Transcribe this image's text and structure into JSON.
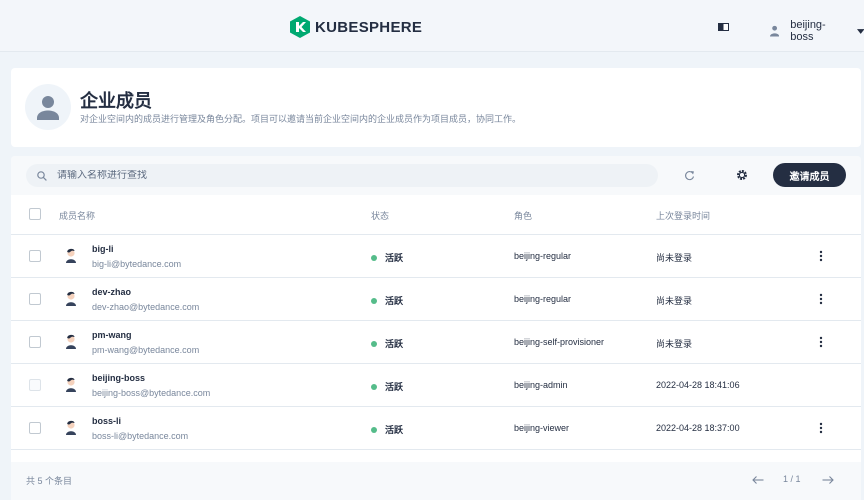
{
  "header": {
    "logo_text": "KUBESPHERE",
    "user_name": "beijing-boss"
  },
  "banner": {
    "title": "企业成员",
    "description": "对企业空间内的成员进行管理及角色分配。项目可以邀请当前企业空间内的企业成员作为项目成员，协同工作。"
  },
  "toolbar": {
    "search_placeholder": "请输入名称进行查找",
    "invite_label": "邀请成员"
  },
  "table": {
    "columns": {
      "name": "成员名称",
      "status": "状态",
      "role": "角色",
      "last_login": "上次登录时间"
    },
    "rows": [
      {
        "name": "big-li",
        "email": "big-li@bytedance.com",
        "status": "活跃",
        "role": "beijing-regular",
        "last_login": "尚未登录"
      },
      {
        "name": "dev-zhao",
        "email": "dev-zhao@bytedance.com",
        "status": "活跃",
        "role": "beijing-regular",
        "last_login": "尚未登录"
      },
      {
        "name": "pm-wang",
        "email": "pm-wang@bytedance.com",
        "status": "活跃",
        "role": "beijing-self-provisioner",
        "last_login": "尚未登录"
      },
      {
        "name": "beijing-boss",
        "email": "beijing-boss@bytedance.com",
        "status": "活跃",
        "role": "beijing-admin",
        "last_login": "2022-04-28 18:41:06"
      },
      {
        "name": "boss-li",
        "email": "boss-li@bytedance.com",
        "status": "活跃",
        "role": "beijing-viewer",
        "last_login": "2022-04-28 18:37:00"
      }
    ]
  },
  "footer": {
    "total": "共 5 个条目",
    "page": "1 / 1"
  },
  "colors": {
    "accent_dark": "#242e42",
    "status_active": "#55bc8a",
    "logo_green": "#00a971"
  }
}
